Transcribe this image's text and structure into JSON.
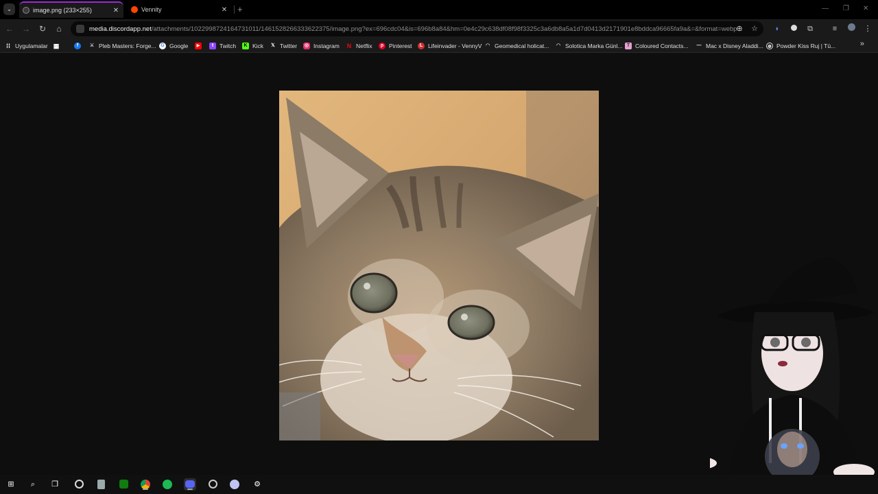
{
  "tabs": [
    {
      "title": "image.png (233×255)",
      "active": true
    },
    {
      "title": "Vennity",
      "active": false
    }
  ],
  "tab_menu_icon": "chevron-down-icon",
  "new_tab_label": "+",
  "address": {
    "host": "media.discordapp.net",
    "path": "/attachments/1022998724164731011/1461528266333622375/image.png?ex=696cdc04&is=696b8a84&hm=0e4c29c638df08f98f3325c3a6db8a5a1d7d0413d2171901e8bddca96665fa9a&=&format=webp..."
  },
  "bookmarks": [
    {
      "label": "Uygulamalar",
      "icon": "apps-grid-icon",
      "color": "#ffffff"
    },
    {
      "label": "",
      "icon": "facebook-icon",
      "color": "#1877f2"
    },
    {
      "label": "Pleb Masters: Forge...",
      "icon": "sword-icon",
      "color": "#cccccc"
    },
    {
      "label": "Google",
      "icon": "google-icon",
      "color": "#ffffff"
    },
    {
      "label": "",
      "icon": "youtube-icon",
      "color": "#ff0000"
    },
    {
      "label": "Twitch",
      "icon": "twitch-icon",
      "color": "#9146ff"
    },
    {
      "label": "Kick",
      "icon": "kick-icon",
      "color": "#53fc18"
    },
    {
      "label": "Twitter",
      "icon": "x-icon",
      "color": "#ffffff"
    },
    {
      "label": "Instagram",
      "icon": "instagram-icon",
      "color": "#e1306c"
    },
    {
      "label": "Netflix",
      "icon": "netflix-icon",
      "color": "#e50914"
    },
    {
      "label": "Pinterest",
      "icon": "pinterest-icon",
      "color": "#e60023"
    },
    {
      "label": "Lifeinvader - VennyV",
      "icon": "lifeinvader-icon",
      "color": "#d32f2f"
    },
    {
      "label": "Geomedical holicat...",
      "icon": "geomedical-icon",
      "color": "#cccccc"
    },
    {
      "label": "Solotica Marka Günl...",
      "icon": "solotica-icon",
      "color": "#cccccc"
    },
    {
      "label": "Coloured Contacts...",
      "icon": "contacts-icon",
      "color": "#e6a0d0"
    },
    {
      "label": "Mac x Disney Aladdi...",
      "icon": "mac-icon",
      "color": "#ffffff"
    },
    {
      "label": "Powder Kiss Ruj | Tü...",
      "icon": "globe-icon",
      "color": "#ffffff"
    }
  ],
  "bookmarks_overflow_icon": "double-chevron-right-icon",
  "image": {
    "width": 233,
    "height": 255,
    "subject": "tabby kitten"
  },
  "taskbar": [
    {
      "icon": "windows-start-icon"
    },
    {
      "icon": "search-icon"
    },
    {
      "icon": "task-view-icon"
    },
    {
      "icon": "obs-icon"
    },
    {
      "icon": "calculator-icon"
    },
    {
      "icon": "xbox-icon"
    },
    {
      "icon": "chrome-icon"
    },
    {
      "icon": "spotify-icon"
    },
    {
      "icon": "discord-icon",
      "active": true
    },
    {
      "icon": "recorder-icon"
    },
    {
      "icon": "vencord-icon"
    },
    {
      "icon": "settings-gear-icon"
    }
  ]
}
